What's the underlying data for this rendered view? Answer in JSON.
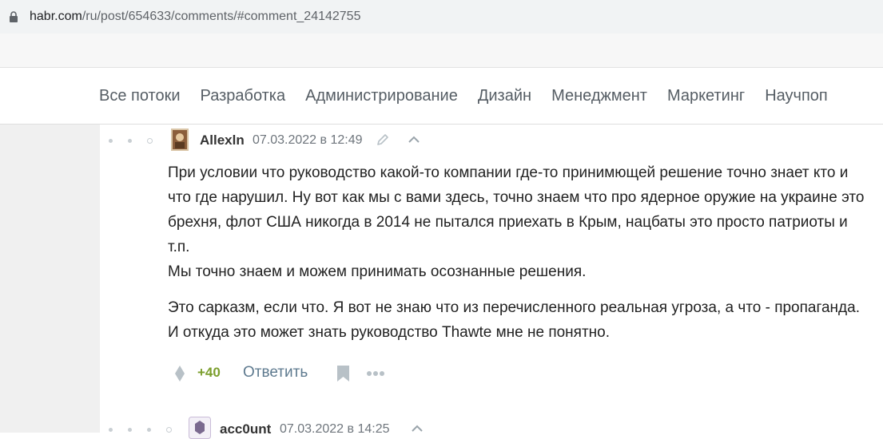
{
  "browser": {
    "url_host": "habr.com",
    "url_path": "/ru/post/654633/comments/#comment_24142755",
    "lock_icon": "lock-icon"
  },
  "nav": {
    "items": [
      "Все потоки",
      "Разработка",
      "Администрирование",
      "Дизайн",
      "Менеджмент",
      "Маркетинг",
      "Научпоп"
    ]
  },
  "comment": {
    "author": "Allexln",
    "date": "07.03.2022 в 12:49",
    "paragraph1": "При условии что руководство какой-то компании где-то принимющей решение точно знает кто и что где нарушил. Ну вот как мы с вами здесь, точно знаем что про ядерное оружие на украине это брехня, флот США никогда в 2014 не пытался приехать в Крым, нацбаты это просто патриоты и т.п.",
    "paragraph1b": "Мы точно знаем и можем принимать осознанные решения.",
    "paragraph2": "Это сарказм, если что. Я вот не знаю что из перечисленного реальная угроза, а что - пропаганда. И откуда это может знать руководство Thawte мне не понятно.",
    "score": "+40",
    "reply_label": "Ответить"
  },
  "next_comment": {
    "author": "acc0unt",
    "date": "07.03.2022 в 14:25"
  },
  "colors": {
    "score": "#7b9e2c",
    "reply": "#5e7a8f",
    "nav_text": "#555d64"
  }
}
